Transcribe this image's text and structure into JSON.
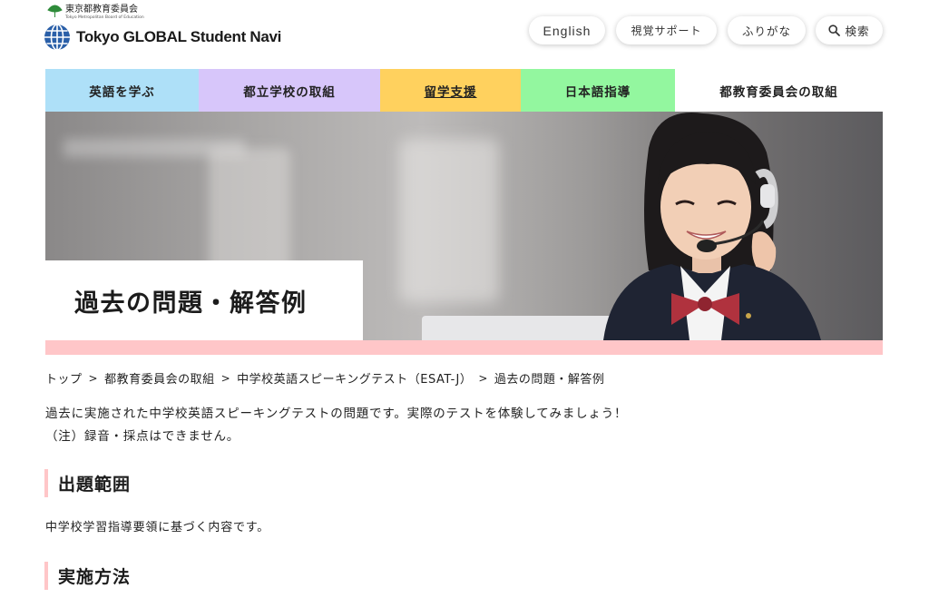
{
  "header": {
    "org_name": "東京都教育委員会",
    "org_name_en": "Tokyo Metropolitan Board of Education",
    "site_name": "Tokyo GLOBAL Student Navi",
    "utility": {
      "english": "English",
      "visual_support": "視覚サポート",
      "furigana": "ふりがな",
      "search": "検索"
    }
  },
  "nav": [
    {
      "label": "英語を学ぶ",
      "color": "#aee0f8"
    },
    {
      "label": "都立学校の取組",
      "color": "#d7c6fa"
    },
    {
      "label": "留学支援",
      "color": "#ffd15e"
    },
    {
      "label": "日本語指導",
      "color": "#93f79f"
    },
    {
      "label": "都教育委員会の取組",
      "color": "#ffffff"
    }
  ],
  "hero": {
    "title": "過去の問題・解答例"
  },
  "breadcrumb": [
    "トップ",
    "都教育委員会の取組",
    "中学校英語スピーキングテスト（ESAT-J）",
    "過去の問題・解答例"
  ],
  "breadcrumb_separator": ">",
  "lead": {
    "line1": "過去に実施された中学校英語スピーキングテストの問題です。実際のテストを体験してみましょう！",
    "line2": "（注）録音・採点はできません。"
  },
  "sections": [
    {
      "heading": "出題範囲",
      "text": "中学校学習指導要領に基づく内容です。"
    },
    {
      "heading": "実施方法"
    }
  ],
  "colors": {
    "accent_pink": "#ffc6c8"
  }
}
